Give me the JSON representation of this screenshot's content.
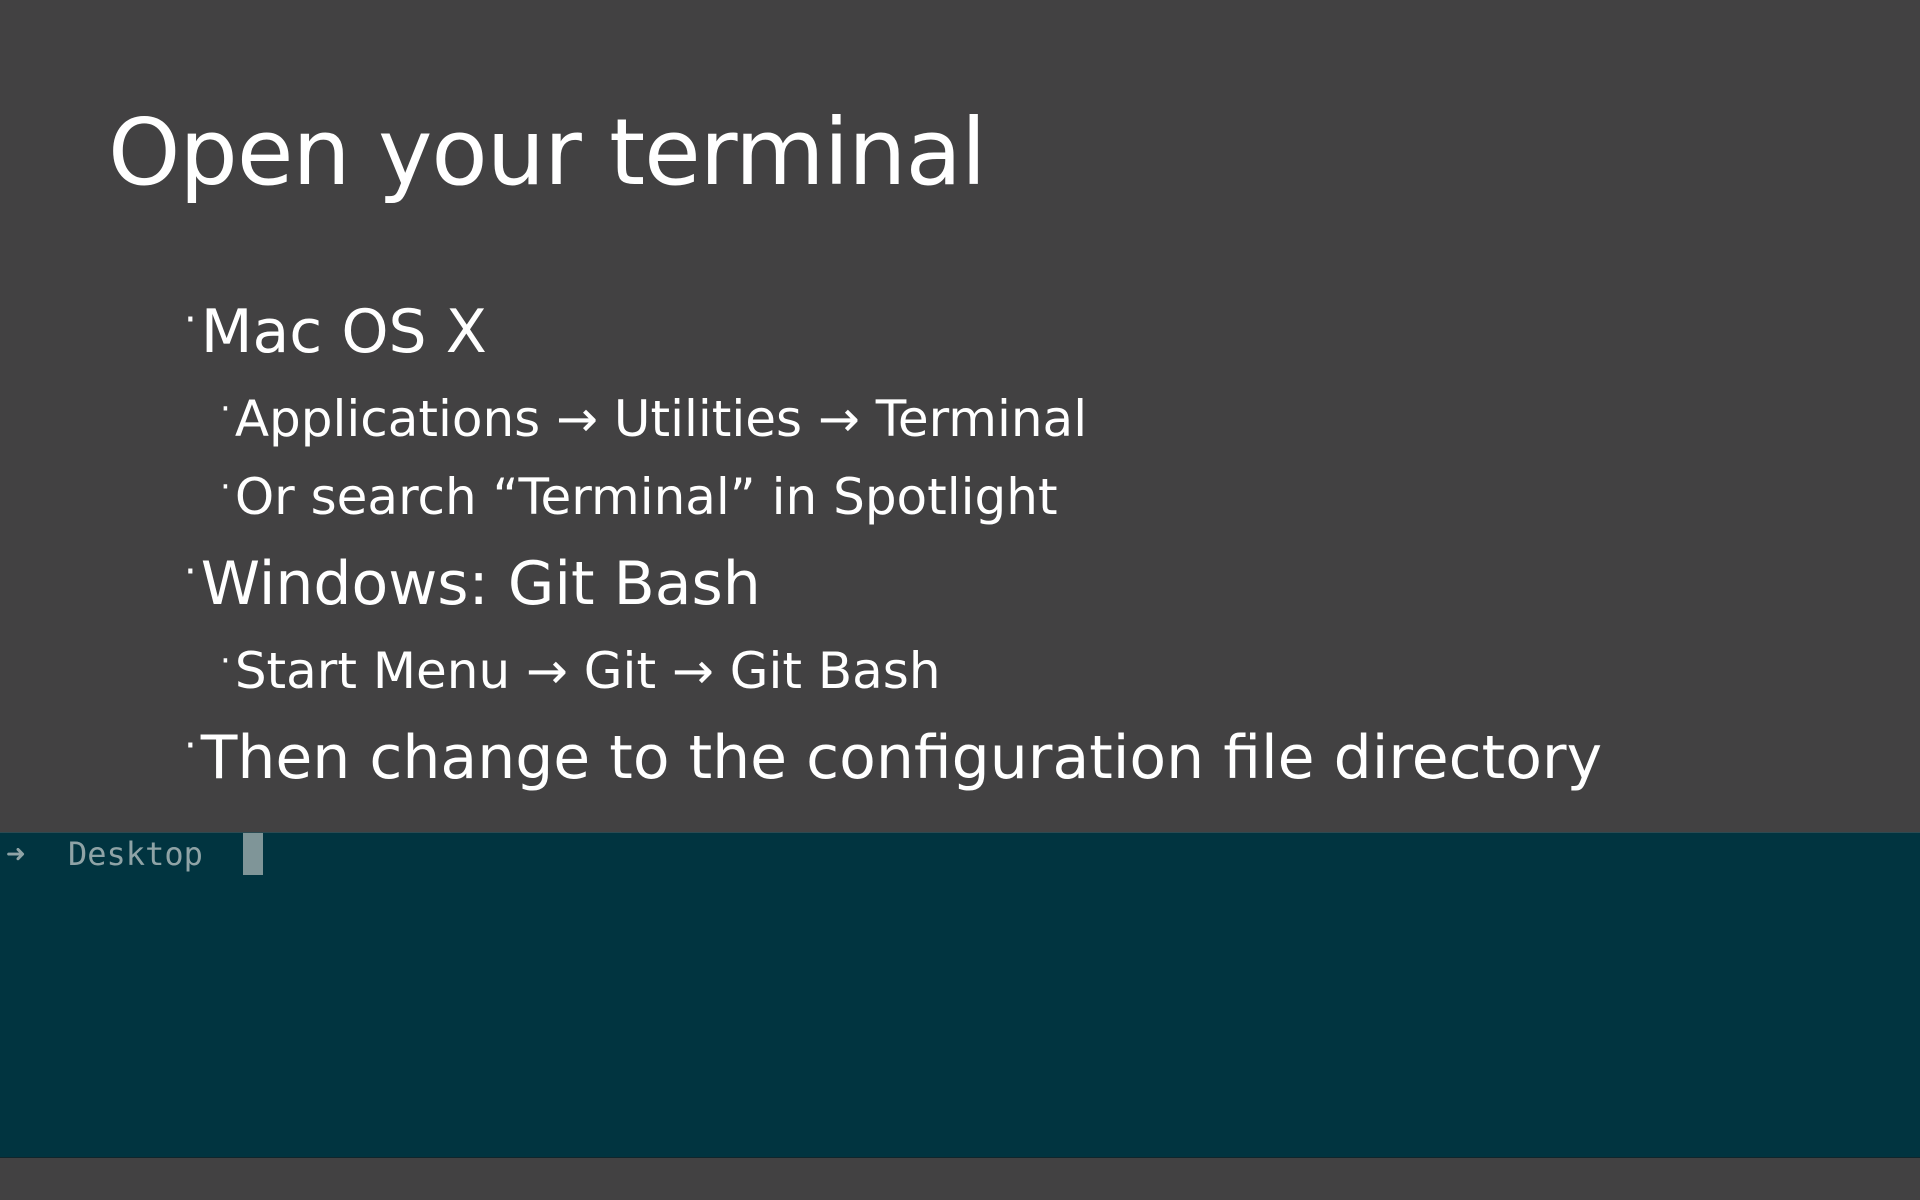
{
  "slide": {
    "title": "Open your terminal",
    "bullets": [
      {
        "level": 1,
        "text": "Mac OS X"
      },
      {
        "level": 2,
        "text": "Applications → Utilities → Terminal"
      },
      {
        "level": 2,
        "text": "Or search “Terminal” in Spotlight"
      },
      {
        "level": 1,
        "text": "Windows: Git Bash"
      },
      {
        "level": 2,
        "text": "Start Menu → Git → Git Bash"
      },
      {
        "level": 1,
        "text": "Then change to the configuration file directory"
      }
    ],
    "bullet_glyph": "·"
  },
  "terminal": {
    "prompt_symbol": "➜",
    "directory": "Desktop",
    "background_color": "#013440",
    "text_color": "#8fa3a6"
  },
  "colors": {
    "slide_background": "#424142",
    "text": "#ffffff"
  }
}
